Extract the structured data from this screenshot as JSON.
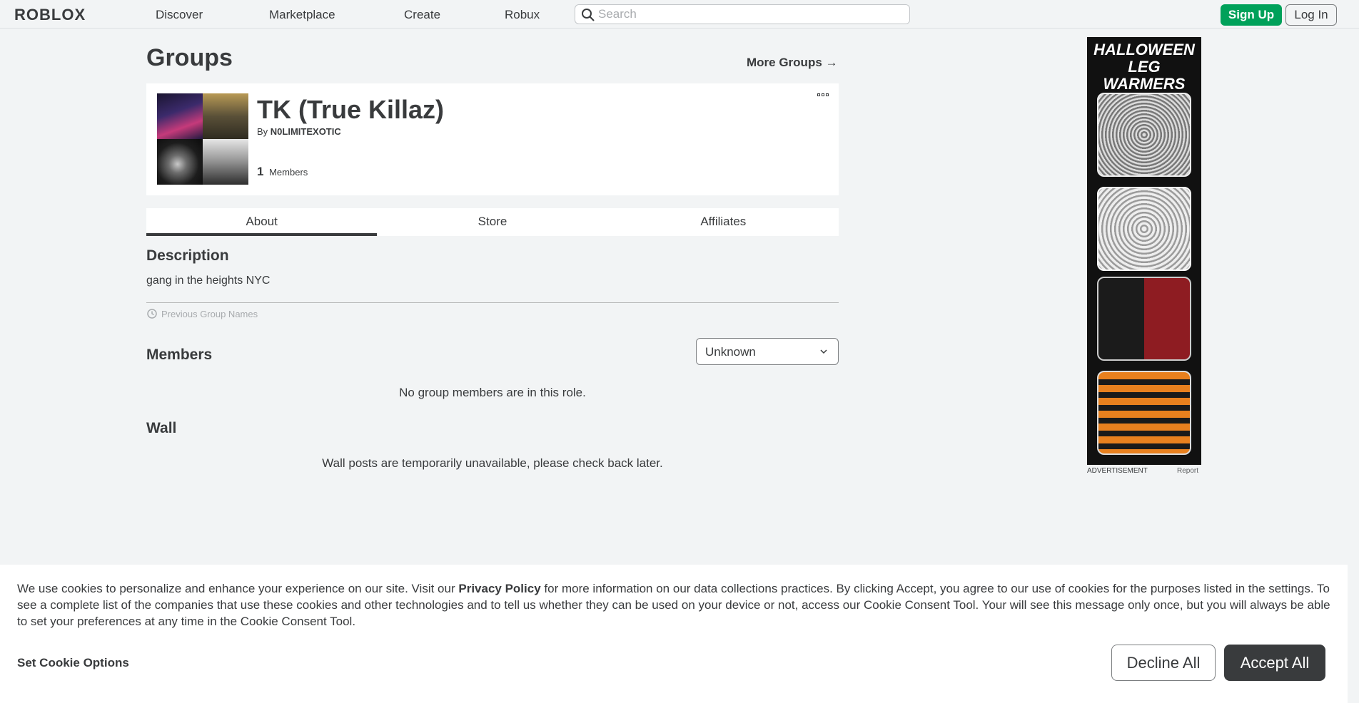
{
  "nav": {
    "logo": "ROBLOX",
    "links": [
      "Discover",
      "Marketplace",
      "Create",
      "Robux"
    ],
    "search_placeholder": "Search",
    "signup_label": "Sign Up",
    "login_label": "Log In"
  },
  "page": {
    "title": "Groups",
    "more_groups": "More Groups →"
  },
  "group": {
    "name": "TK (True Killaz)",
    "by_prefix": "By",
    "owner": "N0LIMITEXOTIC",
    "member_count": "1",
    "members_label": "Members"
  },
  "tabs": [
    "About",
    "Store",
    "Affiliates"
  ],
  "about": {
    "description_heading": "Description",
    "description": "gang in the heights NYC",
    "previous_names": "Previous Group Names",
    "members_heading": "Members",
    "role_selected": "Unknown",
    "no_members": "No group members are in this role.",
    "wall_heading": "Wall",
    "wall_unavailable": "Wall posts are temporarily unavailable, please check back later."
  },
  "ad": {
    "title_line1": "HALLOWEEN",
    "title_line2": "LEG WARMERS",
    "label": "ADVERTISEMENT",
    "report": "Report"
  },
  "cookie": {
    "text_before": "We use cookies to personalize and enhance your experience on our site. Visit our ",
    "privacy_policy": "Privacy Policy",
    "text_after": " for more information on our data collections practices. By clicking Accept, you agree to our use of cookies for the purposes listed in the settings. To see a complete list of the companies that use these cookies and other technologies and to tell us whether they can be used on your device or not, access our Cookie Consent Tool. Your will see this message only once, but you will always be able to set your preferences at any time in the Cookie Consent Tool.",
    "set_options": "Set Cookie Options",
    "decline": "Decline All",
    "accept": "Accept All"
  }
}
